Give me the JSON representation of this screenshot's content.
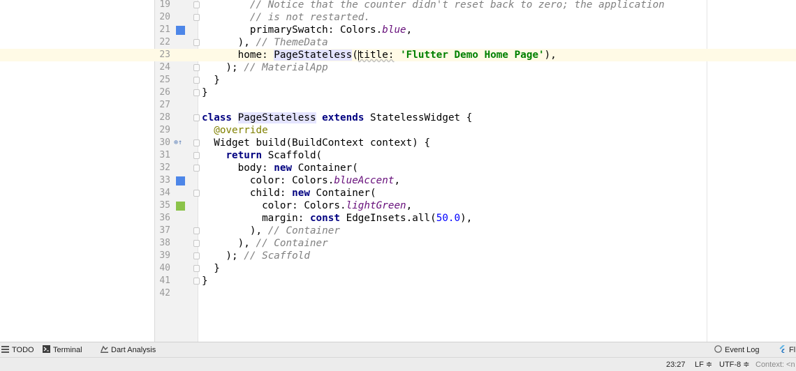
{
  "editor": {
    "lines": [
      {
        "num": "19",
        "fold": true,
        "segments": [
          {
            "t": "        "
          },
          {
            "t": "// Notice that the counter didn't reset back to zero; the application",
            "c": "cm"
          }
        ]
      },
      {
        "num": "20",
        "fold": true,
        "segments": [
          {
            "t": "        "
          },
          {
            "t": "// is not restarted.",
            "c": "cm"
          }
        ]
      },
      {
        "num": "21",
        "swatch": "#4d86e8",
        "segments": [
          {
            "t": "        primarySwatch: Colors."
          },
          {
            "t": "blue",
            "c": "fld"
          },
          {
            "t": ","
          }
        ]
      },
      {
        "num": "22",
        "fold": true,
        "segments": [
          {
            "t": "      ), "
          },
          {
            "t": "// ThemeData",
            "c": "cm"
          }
        ]
      },
      {
        "num": "23",
        "current": true,
        "segments": [
          {
            "t": "      home: "
          },
          {
            "t": "PageStateless",
            "c": "hl"
          },
          {
            "t": "("
          },
          {
            "caret": true
          },
          {
            "t": "title:",
            "c": "err"
          },
          {
            "t": " "
          },
          {
            "t": "'Flutter Demo Home Page'",
            "c": "str"
          },
          {
            "t": "),"
          }
        ]
      },
      {
        "num": "24",
        "fold": true,
        "segments": [
          {
            "t": "    ); "
          },
          {
            "t": "// MaterialApp",
            "c": "cm"
          }
        ]
      },
      {
        "num": "25",
        "fold": true,
        "segments": [
          {
            "t": "  }"
          }
        ]
      },
      {
        "num": "26",
        "fold": true,
        "segments": [
          {
            "t": "}"
          }
        ]
      },
      {
        "num": "27",
        "segments": [
          {
            "t": ""
          }
        ]
      },
      {
        "num": "28",
        "fold": true,
        "segments": [
          {
            "t": "class ",
            "c": "kw"
          },
          {
            "t": "PageStateless",
            "c": "hl"
          },
          {
            "t": " "
          },
          {
            "t": "extends",
            "c": "kw"
          },
          {
            "t": " StatelessWidget {"
          }
        ]
      },
      {
        "num": "29",
        "segments": [
          {
            "t": "  "
          },
          {
            "t": "@override",
            "c": "ann"
          }
        ]
      },
      {
        "num": "30",
        "gmark": "⊚↑",
        "fold": true,
        "segments": [
          {
            "t": "  Widget build(BuildContext context) {"
          }
        ]
      },
      {
        "num": "31",
        "fold": true,
        "segments": [
          {
            "t": "    "
          },
          {
            "t": "return",
            "c": "kw"
          },
          {
            "t": " Scaffold("
          }
        ]
      },
      {
        "num": "32",
        "fold": true,
        "segments": [
          {
            "t": "      body: "
          },
          {
            "t": "new",
            "c": "kw"
          },
          {
            "t": " Container("
          }
        ]
      },
      {
        "num": "33",
        "swatch": "#4d86e8",
        "segments": [
          {
            "t": "        color: Colors."
          },
          {
            "t": "blueAccent",
            "c": "fld"
          },
          {
            "t": ","
          }
        ]
      },
      {
        "num": "34",
        "fold": true,
        "segments": [
          {
            "t": "        child: "
          },
          {
            "t": "new",
            "c": "kw"
          },
          {
            "t": " Container("
          }
        ]
      },
      {
        "num": "35",
        "swatch": "#8bc34a",
        "segments": [
          {
            "t": "          color: Colors."
          },
          {
            "t": "lightGreen",
            "c": "fld"
          },
          {
            "t": ","
          }
        ]
      },
      {
        "num": "36",
        "segments": [
          {
            "t": "          margin: "
          },
          {
            "t": "const",
            "c": "kw"
          },
          {
            "t": " EdgeInsets.all("
          },
          {
            "t": "50.0",
            "c": "num"
          },
          {
            "t": "),"
          }
        ]
      },
      {
        "num": "37",
        "fold": true,
        "segments": [
          {
            "t": "        ), "
          },
          {
            "t": "// Container",
            "c": "cm"
          }
        ]
      },
      {
        "num": "38",
        "fold": true,
        "segments": [
          {
            "t": "      ), "
          },
          {
            "t": "// Container",
            "c": "cm"
          }
        ]
      },
      {
        "num": "39",
        "fold": true,
        "segments": [
          {
            "t": "    ); "
          },
          {
            "t": "// Scaffold",
            "c": "cm"
          }
        ]
      },
      {
        "num": "40",
        "fold": true,
        "segments": [
          {
            "t": "  }"
          }
        ]
      },
      {
        "num": "41",
        "fold": true,
        "segments": [
          {
            "t": "}"
          }
        ]
      },
      {
        "num": "42",
        "segments": [
          {
            "t": ""
          }
        ]
      }
    ]
  },
  "toolwindows": {
    "todo": "TODO",
    "terminal": "Terminal",
    "dart_analysis": "Dart Analysis",
    "event_log": "Event Log",
    "flutter_cut": "Fl"
  },
  "status": {
    "position": "23:27",
    "line_sep": "LF ≑",
    "encoding": "UTF-8 ≑",
    "context": "Context: <n"
  },
  "icons": {
    "todo": "list-icon",
    "terminal": "terminal-icon",
    "dart_analysis": "dart-analysis-icon",
    "event_log": "event-log-icon",
    "flutter": "flutter-icon"
  },
  "colors": {
    "blue_swatch": "#4d86e8",
    "green_swatch": "#8bc34a",
    "current_line": "#fffae6",
    "keyword": "#000080",
    "string": "#008000",
    "comment": "#808080"
  }
}
